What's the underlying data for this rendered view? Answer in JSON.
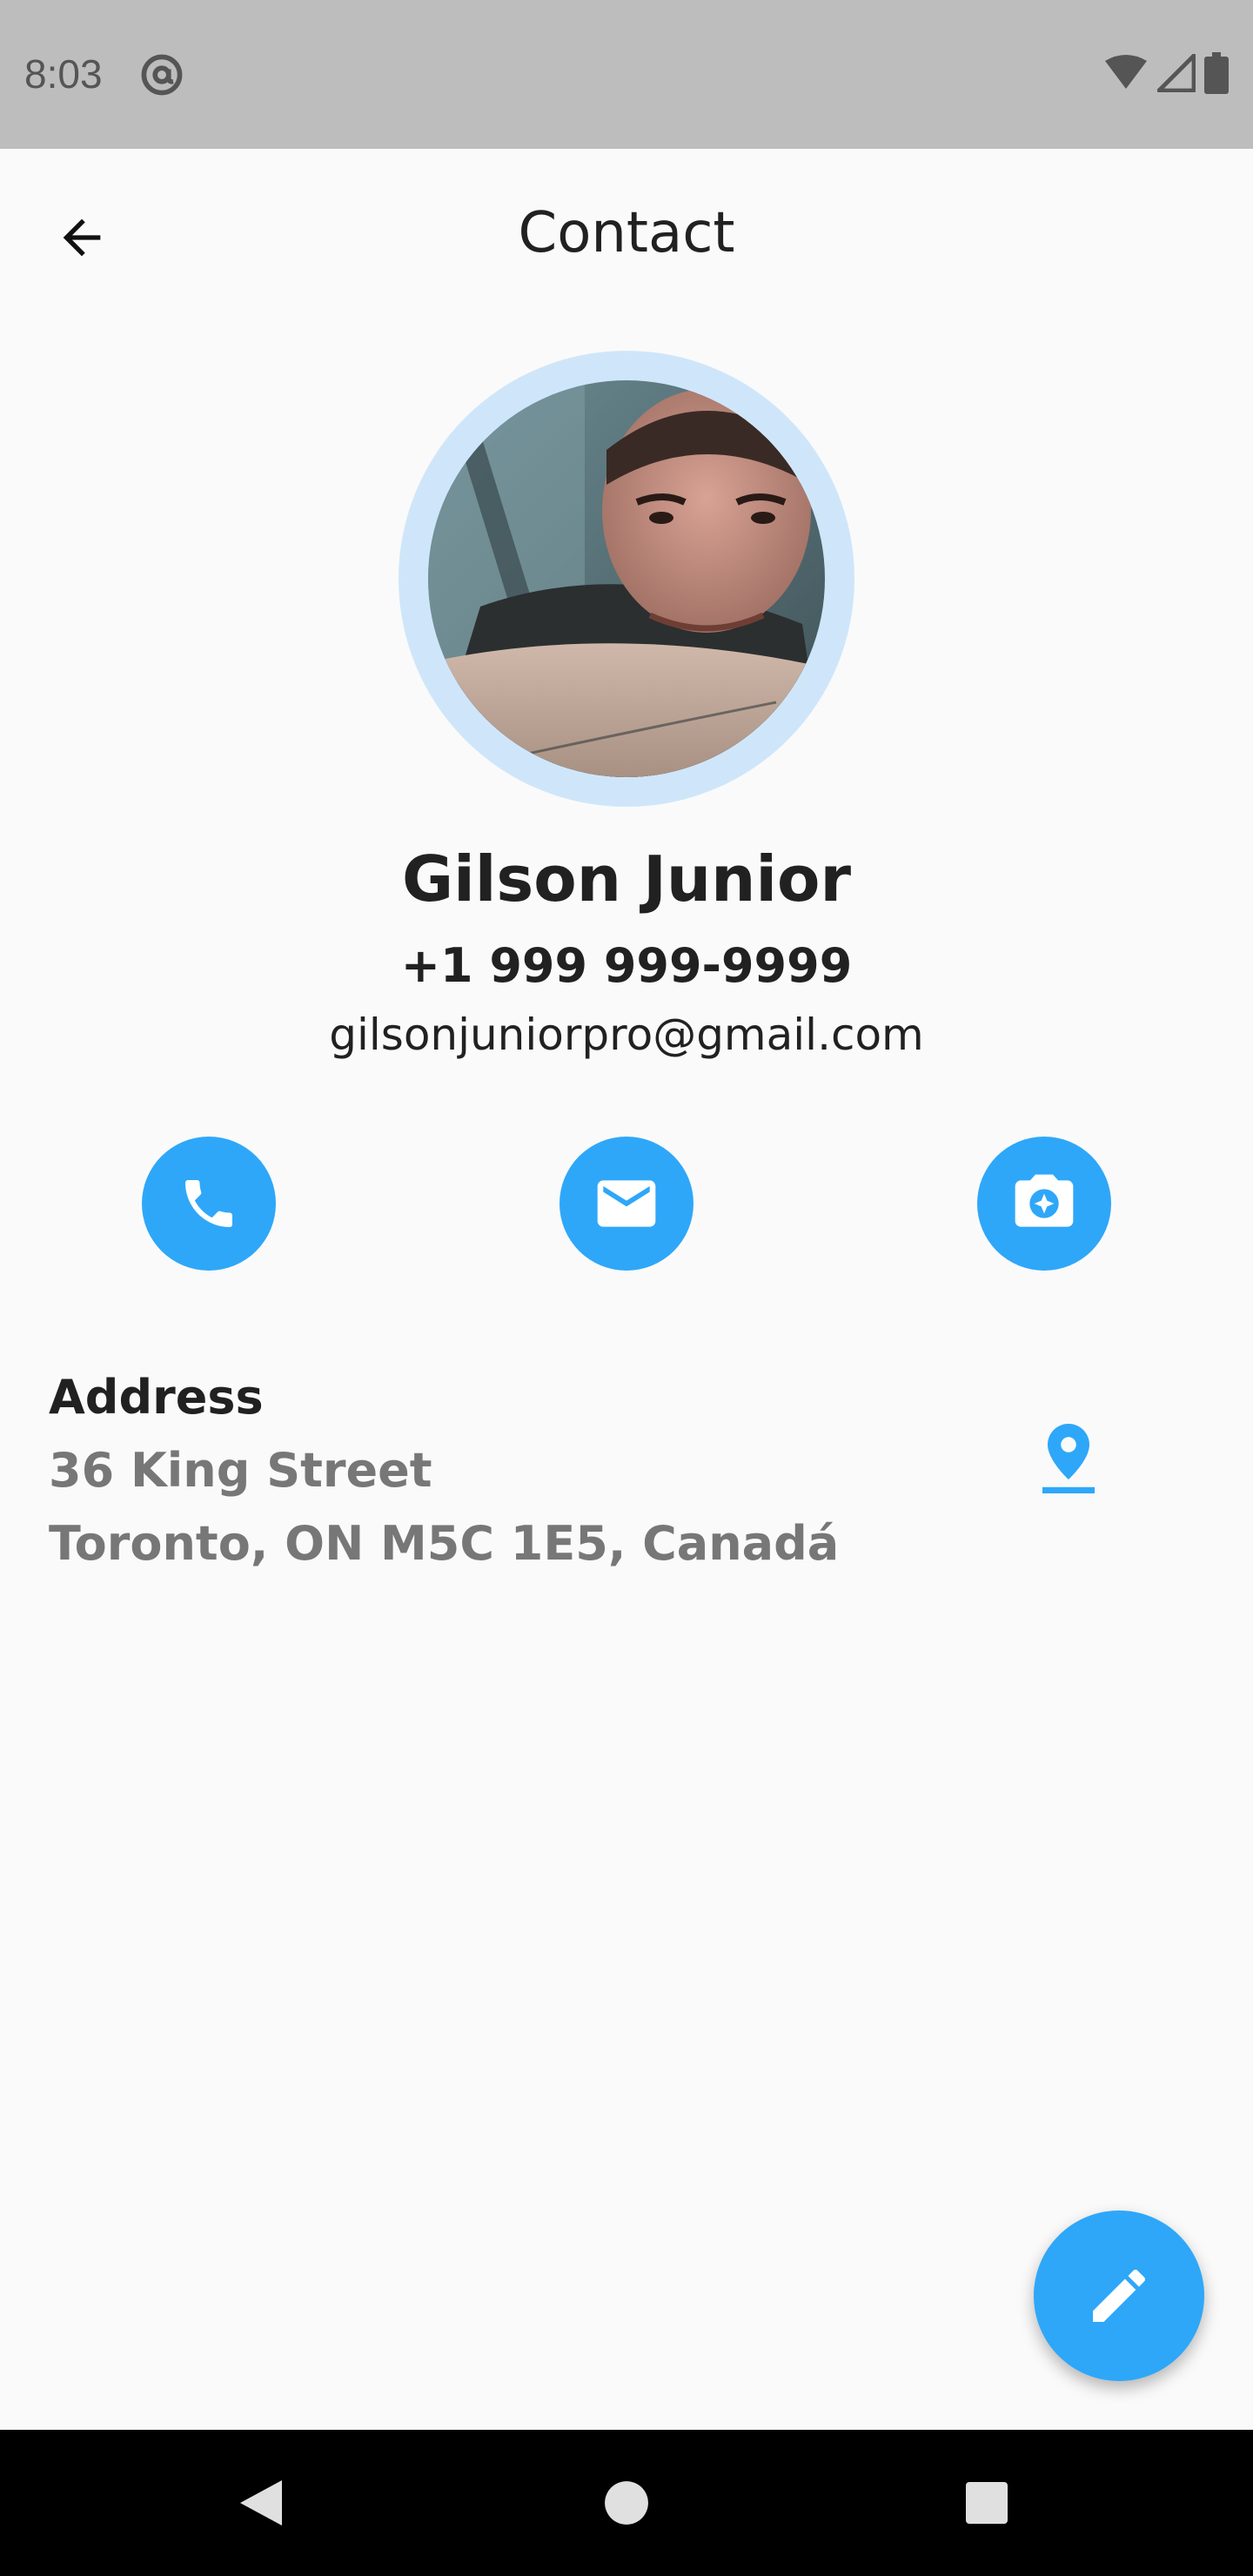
{
  "status_bar": {
    "time": "8:03",
    "icons": [
      "at-sign-icon",
      "wifi-icon",
      "cell-signal-icon",
      "battery-icon"
    ]
  },
  "app_bar": {
    "title": "Contact",
    "back_icon": "arrow-back-icon"
  },
  "contact": {
    "name": "Gilson Junior",
    "phone": "+1 999 999-9999",
    "email": "gilsonjuniorpro@gmail.com"
  },
  "actions": [
    {
      "name": "call",
      "icon": "phone-icon"
    },
    {
      "name": "email",
      "icon": "mail-icon"
    },
    {
      "name": "camera",
      "icon": "camera-icon"
    }
  ],
  "address": {
    "label": "Address",
    "line1": "36 King Street",
    "line2": "Toronto, ON M5C 1E5, Canadá",
    "icon": "map-pin-icon"
  },
  "fab": {
    "icon": "edit-pencil-icon"
  },
  "nav": [
    "back-triangle-icon",
    "home-circle-icon",
    "recents-square-icon"
  ],
  "colors": {
    "accent": "#2ea7f9",
    "avatar_ring": "#cfe6fa",
    "status_bar": "#bdbdbd",
    "background": "#fafafa",
    "text_primary": "#212121",
    "text_secondary": "#777777"
  }
}
